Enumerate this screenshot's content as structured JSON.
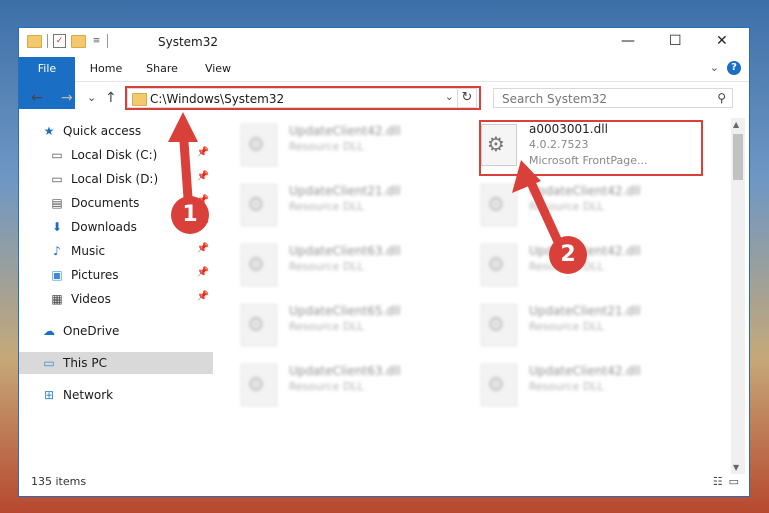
{
  "window": {
    "title": "System32",
    "minimize_glyph": "—",
    "maximize_glyph": "☐",
    "close_glyph": "✕"
  },
  "ribbon": {
    "tabs": [
      "File",
      "Home",
      "Share",
      "View"
    ],
    "help_glyph": "?",
    "expand_glyph": "⌄"
  },
  "address_bar": {
    "back_glyph": "←",
    "forward_glyph": "→",
    "recent_glyph": "⌄",
    "up_glyph": "↑",
    "path": "C:\\Windows\\System32",
    "dropdown_glyph": "⌄",
    "refresh_glyph": "↻"
  },
  "search": {
    "placeholder": "Search System32",
    "icon_glyph": "⚲"
  },
  "nav": {
    "quick_access": {
      "label": "Quick access",
      "icon": "star-icon"
    },
    "items": [
      {
        "label": "Local Disk (C:)",
        "icon": "drive-icon",
        "pinned": true
      },
      {
        "label": "Local Disk (D:)",
        "icon": "drive-icon",
        "pinned": true
      },
      {
        "label": "Documents",
        "icon": "documents-icon",
        "pinned": true
      },
      {
        "label": "Downloads",
        "icon": "downloads-icon",
        "pinned": true
      },
      {
        "label": "Music",
        "icon": "music-icon",
        "pinned": true
      },
      {
        "label": "Pictures",
        "icon": "pictures-icon",
        "pinned": true
      },
      {
        "label": "Videos",
        "icon": "videos-icon",
        "pinned": true
      }
    ],
    "onedrive": {
      "label": "OneDrive",
      "icon": "cloud-icon"
    },
    "this_pc": {
      "label": "This PC",
      "icon": "computer-icon",
      "selected": true
    },
    "network": {
      "label": "Network",
      "icon": "network-icon"
    }
  },
  "files": [
    {
      "name": "UpdateClient42.dll",
      "type": "Resource DLL",
      "blurred": true
    },
    {
      "name": "a0003001.dll",
      "version": "4.0.2.7523",
      "type": "Microsoft FrontPage...",
      "blurred": false
    },
    {
      "name": "UpdateClient21.dll",
      "type": "Resource DLL",
      "blurred": true
    },
    {
      "name": "UpdateClient42.dll",
      "type": "Resource DLL",
      "blurred": true
    },
    {
      "name": "UpdateClient63.dll",
      "type": "Resource DLL",
      "blurred": true
    },
    {
      "name": "UpdateClient42.dll",
      "type": "Resource DLL",
      "blurred": true
    },
    {
      "name": "UpdateClient65.dll",
      "type": "Resource DLL",
      "blurred": true
    },
    {
      "name": "UpdateClient21.dll",
      "type": "Resource DLL",
      "blurred": true
    },
    {
      "name": "UpdateClient63.dll",
      "type": "Resource DLL",
      "blurred": true
    },
    {
      "name": "UpdateClient42.dll",
      "type": "Resource DLL",
      "blurred": true
    }
  ],
  "status": {
    "item_count": "135 items"
  },
  "annotations": {
    "marker_1": "1",
    "marker_2": "2",
    "color": "#d9403a"
  }
}
